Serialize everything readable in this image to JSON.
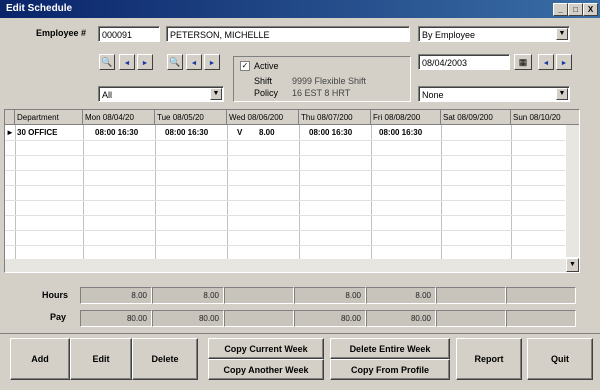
{
  "window": {
    "title": "Edit Schedule"
  },
  "title_buttons": {
    "minimize": "_",
    "restore": "□",
    "close": "X"
  },
  "employee": {
    "label": "Employee #",
    "number": "000091",
    "name": "PETERSON, MICHELLE"
  },
  "view_mode": "By Employee",
  "date": "08/04/2003",
  "location_combo": "All",
  "filter_combo": "None",
  "active_group": {
    "active_label": "Active",
    "active_checked": true,
    "shift_label": "Shift",
    "shift_value": "9999 Flexible Shift",
    "policy_label": "Policy",
    "policy_value": "16 EST 8 HRT"
  },
  "grid": {
    "columns": [
      "Department",
      "Mon 08/04/20",
      "Tue 08/05/20",
      "Wed 08/06/200",
      "Thu 08/07/200",
      "Fri 08/08/200",
      "Sat 08/09/200",
      "Sun 08/10/20"
    ],
    "row": {
      "marker": "►",
      "department": "30 OFFICE",
      "mon": "08:00  16:30",
      "tue": "08:00  16:30",
      "wed_code": "V",
      "wed_hours": "8.00",
      "thu": "08:00  16:30",
      "fri": "08:00  16:30"
    }
  },
  "totals": {
    "hours_label": "Hours",
    "pay_label": "Pay",
    "hours": [
      "8.00",
      "8.00",
      "",
      "8.00",
      "8.00",
      "",
      ""
    ],
    "pay": [
      "80.00",
      "80.00",
      "",
      "80.00",
      "80.00",
      "",
      ""
    ]
  },
  "buttons": {
    "add": "Add",
    "edit": "Edit",
    "delete": "Delete",
    "copy_current_week": "Copy Current Week",
    "copy_another_week": "Copy Another Week",
    "delete_entire_week": "Delete Entire Week",
    "copy_from_profile": "Copy From Profile",
    "report": "Report",
    "quit": "Quit"
  },
  "colors": {
    "titlebar": "#0a246a",
    "face": "#d4d0c8",
    "nav_arrow": "#1a3aa0"
  }
}
